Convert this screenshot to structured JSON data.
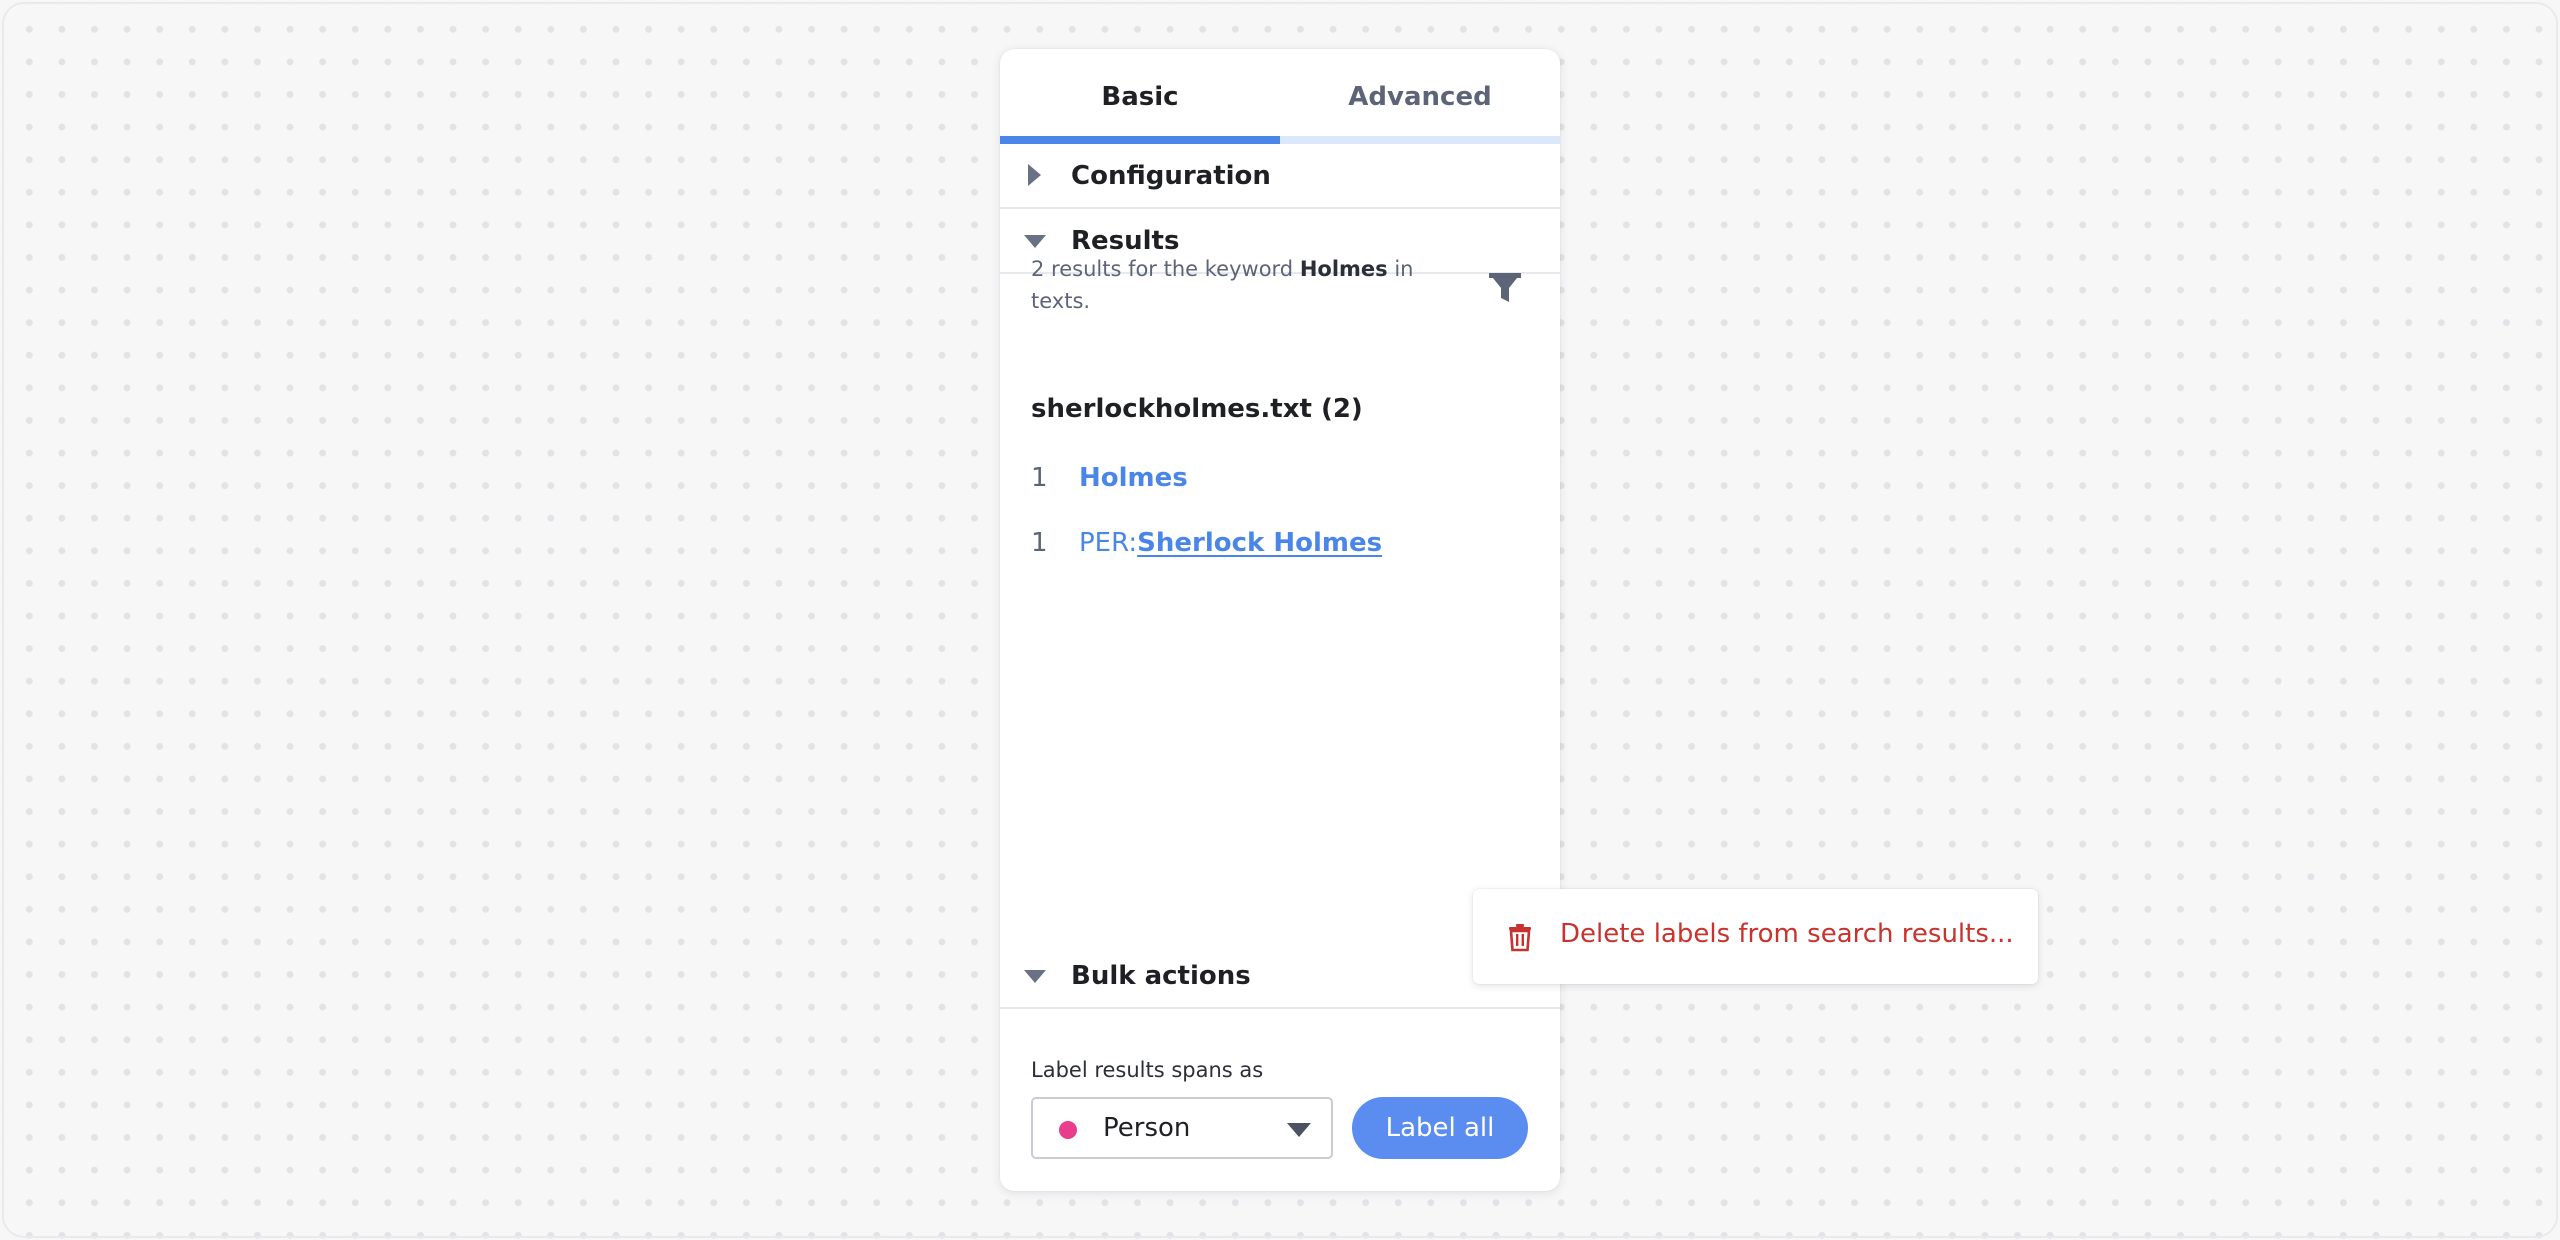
{
  "tabs": {
    "basic": "Basic",
    "advanced": "Advanced",
    "active": "Basic"
  },
  "sections": {
    "configuration": "Configuration",
    "results": "Results",
    "bulk_actions": "Bulk actions"
  },
  "results": {
    "summary_before": "2 results for the keyword ",
    "keyword": "Holmes",
    "summary_after": " in texts.",
    "file": "sherlockholmes.txt (2)",
    "items": [
      {
        "count": "1",
        "prefix": "",
        "label": "Holmes"
      },
      {
        "count": "1",
        "prefix": "PER: ",
        "label": "Sherlock Holmes"
      }
    ]
  },
  "bulk": {
    "caption": "Label results spans as",
    "selected_label": "Person",
    "selected_color": "#e83e8c",
    "button": "Label all"
  },
  "menu": {
    "delete_label": "Delete labels from search results..."
  },
  "colors": {
    "accent": "#4a86e8",
    "danger": "#c8322f"
  },
  "icons": {
    "filter": "filter-icon",
    "kebab": "more-vertical-icon",
    "trash": "trash-icon"
  }
}
